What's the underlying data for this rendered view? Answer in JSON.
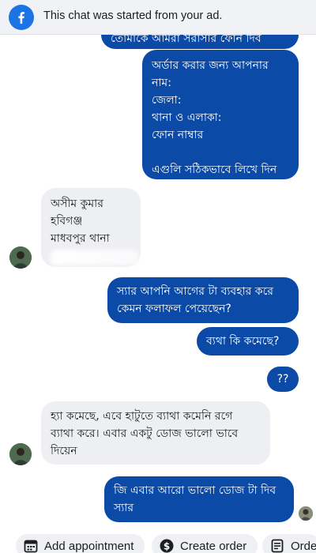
{
  "banner": {
    "text": "This chat was started from your ad."
  },
  "messages": {
    "m0": {
      "lines": [
        "তোমাকে আমরা সরাসরি ফোন দিব"
      ]
    },
    "m1": {
      "lines": [
        "অর্ডার করার জন্য আপনার",
        "নাম:",
        "জেলা:",
        "থানা ও এলাকা:",
        "ফোন নাম্বার"
      ],
      "footer": "এগুলি সঠিকভাবে লিখে দিন"
    },
    "m2": {
      "lines": [
        "অসীম কুমার",
        "হবিগঞ্জ",
        "মাধবপুর থানা"
      ]
    },
    "m3": {
      "lines": [
        "স্যার আপনি আগের টা ব্যবহার করে",
        "কেমন ফলাফল পেয়েছেন?"
      ]
    },
    "m4": {
      "lines": [
        "ব্যথা কি কমেছে?"
      ]
    },
    "m5": {
      "lines": [
        "??"
      ]
    },
    "m6": {
      "lines": [
        "হ্যা কমেছে, এবে হাটুতে ব্যাথা কমেনি রগে",
        "ব্যাথা করে। এবার একটু ডোজ ভালো ভাবে",
        "দিয়েন"
      ]
    },
    "m7": {
      "lines": [
        "জি এবার আরো ভালো ডোজ টা দিব",
        "স্যার"
      ]
    }
  },
  "actions": {
    "add_appointment": "Add appointment",
    "create_order": "Create order",
    "orders": "Orde"
  },
  "icons": {
    "banner": "facebook-icon",
    "add_appointment": "calendar-icon",
    "create_order": "dollar-icon",
    "orders": "receipt-icon"
  },
  "colors": {
    "outgoing": "#0b4aa6",
    "incoming": "#eeeff2",
    "brand": "#1b74e4"
  }
}
